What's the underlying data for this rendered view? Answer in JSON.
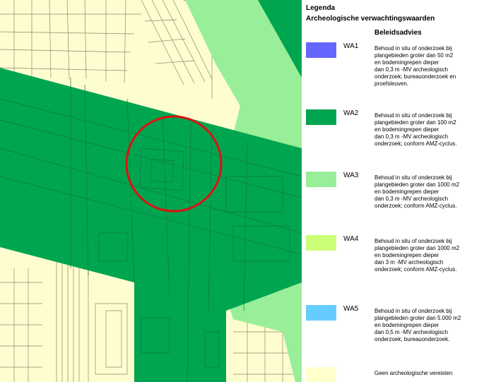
{
  "legend": {
    "title": "Legenda",
    "subtitle": "Archeologische verwachtingswaarden",
    "column_header": "Beleidsadvies",
    "entries": [
      {
        "code": "WA1",
        "color": "#6666ff",
        "text": "Behoud in situ of onderzoek bij\nplangebieden groter dan 50 m2\nen bodemingrepen dieper\ndan 0,3 m -MV archeologisch\nonderzoek; bureauonderzoek en\nproefsleuven."
      },
      {
        "code": "WA2",
        "color": "#00a550",
        "text": "Behoud in situ of onderzoek bij\nplangebieden groter dan 100 m2\nen bodemingrepen dieper\ndan 0,3 m -MV archeologisch\nonderzoek; conform AMZ-cyclus."
      },
      {
        "code": "WA3",
        "color": "#99ee99",
        "text": "Behoud in situ of onderzoek bij\nplangebieden groter dan 1000 m2\nen bodemingrepen dieper\ndan 0,3 m -MV archeologisch\nonderzoek; conform AMZ-cyclus."
      },
      {
        "code": "WA4",
        "color": "#ccff77",
        "text": "Behoud in situ of onderzoek bij\nplangebieden groter dan 1000 m2\nen bodemingrepen dieper\ndan 3 m -MV archeologisch\nonderzoek; conform AMZ-cyclus."
      },
      {
        "code": "WA5",
        "color": "#66ccff",
        "text": "Behoud in situ of onderzoek bij\nplangebieden groter dan 5.000 m2\nen bodemingrepen dieper\ndan 0,5 m -MV archeologisch\nonderzoek; bureauonderzoek."
      },
      {
        "code": "",
        "color": "#ffffcc",
        "text": "Geen archeologische vereisten"
      }
    ]
  },
  "map": {
    "base_color": "#fefdd0",
    "line_color": "#8a8a6a",
    "wa2_color": "#00a550",
    "wa3_color": "#99ee99",
    "marker_color": "#dd1111"
  }
}
